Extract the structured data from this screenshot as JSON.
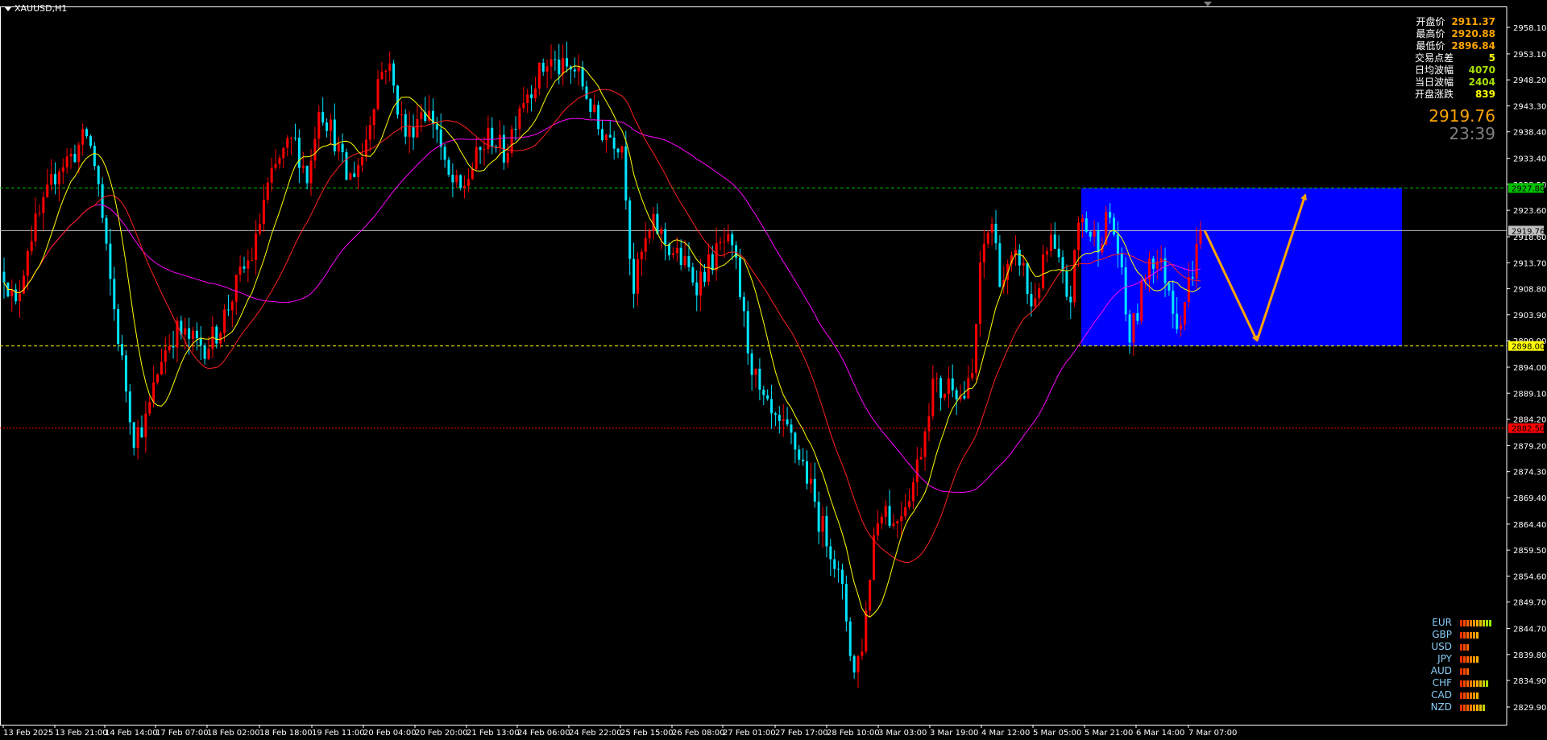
{
  "symbol": "XAUUSD,H1",
  "stats": [
    {
      "label": "开盘价",
      "value": "2911.37",
      "color": "#ffa500"
    },
    {
      "label": "最高价",
      "value": "2920.88",
      "color": "#ffa500"
    },
    {
      "label": "最低价",
      "value": "2896.84",
      "color": "#ffa500"
    },
    {
      "label": "交易点差",
      "value": "5",
      "color": "#ffff00"
    },
    {
      "label": "日均波幅",
      "value": "4070",
      "color": "#a8e000"
    },
    {
      "label": "当日波幅",
      "value": "2404",
      "color": "#a8e000"
    },
    {
      "label": "开盘涨跌",
      "value": "839",
      "color": "#ffff00"
    }
  ],
  "current_price": "2919.76",
  "countdown": "23:39",
  "currency_strength": [
    {
      "currency": "EUR",
      "level": 10
    },
    {
      "currency": "GBP",
      "level": 6
    },
    {
      "currency": "USD",
      "level": 3
    },
    {
      "currency": "JPY",
      "level": 6
    },
    {
      "currency": "AUD",
      "level": 3
    },
    {
      "currency": "CHF",
      "level": 9
    },
    {
      "currency": "CAD",
      "level": 6
    },
    {
      "currency": "NZD",
      "level": 8
    }
  ],
  "colors": {
    "background": "#000000",
    "bull_candle": "#ff0000",
    "bear_candle": "#00e5ff",
    "ma_fast": "#ffff00",
    "ma_mid": "#ff2020",
    "ma_slow": "#ff00ff",
    "zone": "#0000ff",
    "projection_arrow": "#ffa500",
    "level_resistance": "#00c000",
    "level_support": "#ffff00",
    "level_low": "#ff0000",
    "price_line": "#c0c0c0"
  },
  "chart_data": {
    "type": "candlestick",
    "timeframe": "H1",
    "ylim": [
      2829.9,
      2958.1
    ],
    "y_ticks": [
      "2958.10",
      "2953.10",
      "2948.20",
      "2943.30",
      "2938.40",
      "2933.40",
      "2928.50",
      "2923.60",
      "2918.60",
      "2913.70",
      "2908.80",
      "2903.90",
      "2899.00",
      "2894.00",
      "2889.10",
      "2884.20",
      "2879.20",
      "2874.30",
      "2869.40",
      "2864.40",
      "2859.50",
      "2854.60",
      "2849.70",
      "2844.70",
      "2839.80",
      "2834.90",
      "2829.90"
    ],
    "x_ticks": [
      "13 Feb 2025",
      "13 Feb 21:00",
      "14 Feb 14:00",
      "17 Feb 07:00",
      "18 Feb 02:00",
      "18 Feb 18:00",
      "19 Feb 11:00",
      "20 Feb 04:00",
      "20 Feb 20:00",
      "21 Feb 13:00",
      "24 Feb 06:00",
      "24 Feb 22:00",
      "25 Feb 15:00",
      "26 Feb 08:00",
      "27 Feb 01:00",
      "27 Feb 17:00",
      "28 Feb 10:00",
      "3 Mar 03:00",
      "3 Mar 19:00",
      "4 Mar 12:00",
      "5 Mar 05:00",
      "5 Mar 21:00",
      "6 Mar 14:00",
      "7 Mar 07:00"
    ],
    "horizontal_levels": [
      {
        "price": 2927.8,
        "label": "2927.80",
        "style": "dashed",
        "color": "#00c000"
      },
      {
        "price": 2919.76,
        "label": "2919.76",
        "style": "solid",
        "color": "#c0c0c0"
      },
      {
        "price": 2898.0,
        "label": "2898.00",
        "style": "dashed",
        "color": "#ffff00"
      },
      {
        "price": 2882.5,
        "label": "2882.50",
        "style": "dotted",
        "color": "#ff0000"
      }
    ],
    "zone": {
      "price_top": 2927.8,
      "price_bottom": 2898.0,
      "start": "5 Mar 05:00",
      "end": "7 Mar 07:00+"
    },
    "projection": [
      {
        "from_price": 2919.8,
        "to_price": 2899.0
      },
      {
        "from_price": 2899.0,
        "to_price": 2926.5
      }
    ],
    "path_anchors": [
      [
        0,
        2912
      ],
      [
        12,
        2905
      ],
      [
        25,
        2918
      ],
      [
        40,
        2924
      ],
      [
        55,
        2932
      ],
      [
        70,
        2934
      ],
      [
        85,
        2938
      ],
      [
        95,
        2930
      ],
      [
        105,
        2914
      ],
      [
        120,
        2895
      ],
      [
        132,
        2881
      ],
      [
        145,
        2884
      ],
      [
        160,
        2896
      ],
      [
        175,
        2901
      ],
      [
        190,
        2899
      ],
      [
        205,
        2898
      ],
      [
        215,
        2900
      ],
      [
        225,
        2904
      ],
      [
        240,
        2911
      ],
      [
        255,
        2916
      ],
      [
        265,
        2926
      ],
      [
        280,
        2933
      ],
      [
        295,
        2937
      ],
      [
        310,
        2929
      ],
      [
        320,
        2944
      ],
      [
        335,
        2938
      ],
      [
        350,
        2929
      ],
      [
        365,
        2934
      ],
      [
        380,
        2948
      ],
      [
        390,
        2952
      ],
      [
        400,
        2944
      ],
      [
        410,
        2937
      ],
      [
        425,
        2943
      ],
      [
        440,
        2940
      ],
      [
        450,
        2930
      ],
      [
        465,
        2927
      ],
      [
        480,
        2933
      ],
      [
        495,
        2938
      ],
      [
        510,
        2934
      ],
      [
        525,
        2944
      ],
      [
        540,
        2948
      ],
      [
        555,
        2952
      ],
      [
        568,
        2950
      ],
      [
        582,
        2950
      ],
      [
        592,
        2946
      ],
      [
        605,
        2939
      ],
      [
        615,
        2938
      ],
      [
        630,
        2936
      ],
      [
        640,
        2908
      ],
      [
        650,
        2916
      ],
      [
        662,
        2921
      ],
      [
        675,
        2917
      ],
      [
        690,
        2914
      ],
      [
        705,
        2910
      ],
      [
        720,
        2914
      ],
      [
        735,
        2918
      ],
      [
        745,
        2913
      ],
      [
        758,
        2897
      ],
      [
        770,
        2888
      ],
      [
        785,
        2883
      ],
      [
        800,
        2881
      ],
      [
        815,
        2875
      ],
      [
        830,
        2865
      ],
      [
        842,
        2860
      ],
      [
        855,
        2850
      ],
      [
        865,
        2836
      ],
      [
        875,
        2843
      ],
      [
        885,
        2862
      ],
      [
        895,
        2869
      ],
      [
        905,
        2864
      ],
      [
        915,
        2868
      ],
      [
        925,
        2872
      ],
      [
        935,
        2880
      ],
      [
        945,
        2891
      ],
      [
        955,
        2889
      ],
      [
        965,
        2892
      ],
      [
        975,
        2888
      ],
      [
        985,
        2891
      ],
      [
        995,
        2915
      ],
      [
        1005,
        2922
      ],
      [
        1015,
        2910
      ],
      [
        1025,
        2913
      ],
      [
        1035,
        2915
      ],
      [
        1045,
        2905
      ],
      [
        1055,
        2911
      ],
      [
        1065,
        2918
      ],
      [
        1075,
        2912
      ],
      [
        1085,
        2906
      ],
      [
        1095,
        2923
      ],
      [
        1105,
        2919
      ],
      [
        1115,
        2918
      ],
      [
        1125,
        2923
      ],
      [
        1135,
        2915
      ],
      [
        1145,
        2899
      ],
      [
        1155,
        2905
      ],
      [
        1165,
        2915
      ],
      [
        1175,
        2914
      ],
      [
        1185,
        2910
      ],
      [
        1195,
        2902
      ],
      [
        1205,
        2909
      ],
      [
        1212,
        2914
      ],
      [
        1218,
        2919.8
      ]
    ]
  }
}
